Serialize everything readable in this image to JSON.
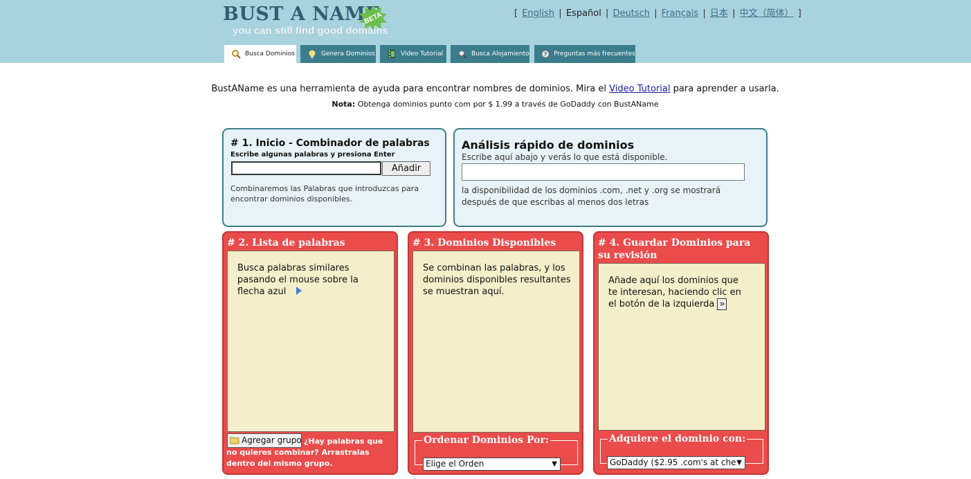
{
  "header": {
    "logo_title": "BUST A NAME",
    "logo_badge": "BETA",
    "logo_tagline": "you can still find good domains",
    "languages": [
      "English",
      "Español",
      "Deutsch",
      "Français",
      "日本",
      "中文（简体）"
    ],
    "current_language": "Español"
  },
  "tabs": [
    {
      "label": "Busca Dominios",
      "icon": "search-icon",
      "active": true
    },
    {
      "label": "Genera Dominios",
      "icon": "lightbulb-icon",
      "active": false
    },
    {
      "label": "Video Tutorial",
      "icon": "film-icon",
      "active": false
    },
    {
      "label": "Busca Alojamiento",
      "icon": "search-icon",
      "active": false
    },
    {
      "label": "Preguntas más frecuentes",
      "icon": "help-icon",
      "active": false
    }
  ],
  "intro": {
    "before": "BustAName es una herramienta de ayuda para encontrar nombres de dominios. Mira el ",
    "link": "Video Tutorial",
    "after": " para aprender a usarla.",
    "note_label": "Nota:",
    "note_text": " Obtenga dominios punto com por $ 1.99 a través de GoDaddy con BustAName"
  },
  "step1": {
    "title": "# 1. Inicio - Combinador de palabras",
    "subtitle": "Escribe algunas palabras y presiona Enter",
    "input_value": "",
    "add_label": "Añadir",
    "description": "Combinaremos las Palabras que introduzcas para encontrar dominios disponibles."
  },
  "quick": {
    "title": "Análisis rápido de dominios",
    "subtitle": "Escribe aquí abajo y verás lo que está disponible.",
    "input_value": "",
    "description": "la disponibilidad de los dominios .com, .net y .org se mostrará después de que escribas al menos dos letras"
  },
  "step2": {
    "title": "# 2. Lista de palabras",
    "body": "Busca palabras similares pasando el mouse sobre la flecha azul",
    "group_button": "Agregar grupo",
    "group_note": "¿Hay palabras que no quieres combinar? Arrastralas dentro del mismo grupo."
  },
  "step3": {
    "title": "# 3. Dominios Disponibles",
    "body": "Se combinan las palabras, y los dominios disponibles resultantes se muestran aquí.",
    "order_legend": "Ordenar Dominios Por:",
    "order_selected": "Elige el Orden"
  },
  "step4": {
    "title": "# 4. Guardar Dominios para su revisión",
    "body": "Añade aquí los dominios que te interesan, haciendo clic en el botón de la izquierda",
    "button_glyph": "»",
    "acquire_legend": "Adquiere el dominio con:",
    "acquire_selected": "GoDaddy ($2.95 .com's at che"
  },
  "colors": {
    "header_bg": "#a8d3de",
    "tab_bg": "#3b7d8c",
    "blue_panel_bg": "#e7f3f8",
    "red_panel_bg": "#ea4b4b",
    "inner_bg": "#f5eecb"
  }
}
